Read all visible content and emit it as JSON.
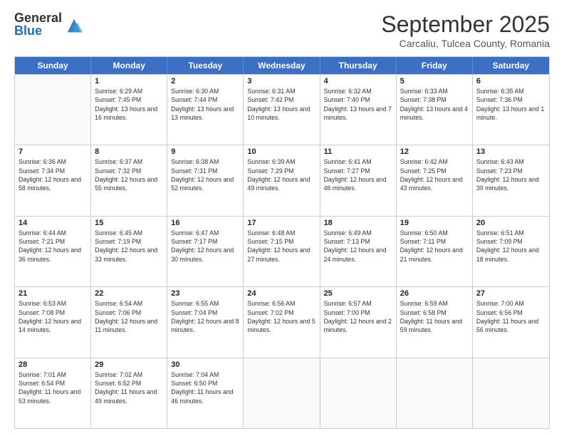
{
  "logo": {
    "general": "General",
    "blue": "Blue"
  },
  "title": "September 2025",
  "location": "Carcaliu, Tulcea County, Romania",
  "days": [
    "Sunday",
    "Monday",
    "Tuesday",
    "Wednesday",
    "Thursday",
    "Friday",
    "Saturday"
  ],
  "rows": [
    [
      {
        "day": "",
        "sunrise": "",
        "sunset": "",
        "daylight": ""
      },
      {
        "day": "1",
        "sunrise": "Sunrise: 6:29 AM",
        "sunset": "Sunset: 7:45 PM",
        "daylight": "Daylight: 13 hours and 16 minutes."
      },
      {
        "day": "2",
        "sunrise": "Sunrise: 6:30 AM",
        "sunset": "Sunset: 7:44 PM",
        "daylight": "Daylight: 13 hours and 13 minutes."
      },
      {
        "day": "3",
        "sunrise": "Sunrise: 6:31 AM",
        "sunset": "Sunset: 7:42 PM",
        "daylight": "Daylight: 13 hours and 10 minutes."
      },
      {
        "day": "4",
        "sunrise": "Sunrise: 6:32 AM",
        "sunset": "Sunset: 7:40 PM",
        "daylight": "Daylight: 13 hours and 7 minutes."
      },
      {
        "day": "5",
        "sunrise": "Sunrise: 6:33 AM",
        "sunset": "Sunset: 7:38 PM",
        "daylight": "Daylight: 13 hours and 4 minutes."
      },
      {
        "day": "6",
        "sunrise": "Sunrise: 6:35 AM",
        "sunset": "Sunset: 7:36 PM",
        "daylight": "Daylight: 13 hours and 1 minute."
      }
    ],
    [
      {
        "day": "7",
        "sunrise": "Sunrise: 6:36 AM",
        "sunset": "Sunset: 7:34 PM",
        "daylight": "Daylight: 12 hours and 58 minutes."
      },
      {
        "day": "8",
        "sunrise": "Sunrise: 6:37 AM",
        "sunset": "Sunset: 7:32 PM",
        "daylight": "Daylight: 12 hours and 55 minutes."
      },
      {
        "day": "9",
        "sunrise": "Sunrise: 6:38 AM",
        "sunset": "Sunset: 7:31 PM",
        "daylight": "Daylight: 12 hours and 52 minutes."
      },
      {
        "day": "10",
        "sunrise": "Sunrise: 6:39 AM",
        "sunset": "Sunset: 7:29 PM",
        "daylight": "Daylight: 12 hours and 49 minutes."
      },
      {
        "day": "11",
        "sunrise": "Sunrise: 6:41 AM",
        "sunset": "Sunset: 7:27 PM",
        "daylight": "Daylight: 12 hours and 46 minutes."
      },
      {
        "day": "12",
        "sunrise": "Sunrise: 6:42 AM",
        "sunset": "Sunset: 7:25 PM",
        "daylight": "Daylight: 12 hours and 43 minutes."
      },
      {
        "day": "13",
        "sunrise": "Sunrise: 6:43 AM",
        "sunset": "Sunset: 7:23 PM",
        "daylight": "Daylight: 12 hours and 39 minutes."
      }
    ],
    [
      {
        "day": "14",
        "sunrise": "Sunrise: 6:44 AM",
        "sunset": "Sunset: 7:21 PM",
        "daylight": "Daylight: 12 hours and 36 minutes."
      },
      {
        "day": "15",
        "sunrise": "Sunrise: 6:45 AM",
        "sunset": "Sunset: 7:19 PM",
        "daylight": "Daylight: 12 hours and 33 minutes."
      },
      {
        "day": "16",
        "sunrise": "Sunrise: 6:47 AM",
        "sunset": "Sunset: 7:17 PM",
        "daylight": "Daylight: 12 hours and 30 minutes."
      },
      {
        "day": "17",
        "sunrise": "Sunrise: 6:48 AM",
        "sunset": "Sunset: 7:15 PM",
        "daylight": "Daylight: 12 hours and 27 minutes."
      },
      {
        "day": "18",
        "sunrise": "Sunrise: 6:49 AM",
        "sunset": "Sunset: 7:13 PM",
        "daylight": "Daylight: 12 hours and 24 minutes."
      },
      {
        "day": "19",
        "sunrise": "Sunrise: 6:50 AM",
        "sunset": "Sunset: 7:11 PM",
        "daylight": "Daylight: 12 hours and 21 minutes."
      },
      {
        "day": "20",
        "sunrise": "Sunrise: 6:51 AM",
        "sunset": "Sunset: 7:09 PM",
        "daylight": "Daylight: 12 hours and 18 minutes."
      }
    ],
    [
      {
        "day": "21",
        "sunrise": "Sunrise: 6:53 AM",
        "sunset": "Sunset: 7:08 PM",
        "daylight": "Daylight: 12 hours and 14 minutes."
      },
      {
        "day": "22",
        "sunrise": "Sunrise: 6:54 AM",
        "sunset": "Sunset: 7:06 PM",
        "daylight": "Daylight: 12 hours and 11 minutes."
      },
      {
        "day": "23",
        "sunrise": "Sunrise: 6:55 AM",
        "sunset": "Sunset: 7:04 PM",
        "daylight": "Daylight: 12 hours and 8 minutes."
      },
      {
        "day": "24",
        "sunrise": "Sunrise: 6:56 AM",
        "sunset": "Sunset: 7:02 PM",
        "daylight": "Daylight: 12 hours and 5 minutes."
      },
      {
        "day": "25",
        "sunrise": "Sunrise: 6:57 AM",
        "sunset": "Sunset: 7:00 PM",
        "daylight": "Daylight: 12 hours and 2 minutes."
      },
      {
        "day": "26",
        "sunrise": "Sunrise: 6:59 AM",
        "sunset": "Sunset: 6:58 PM",
        "daylight": "Daylight: 11 hours and 59 minutes."
      },
      {
        "day": "27",
        "sunrise": "Sunrise: 7:00 AM",
        "sunset": "Sunset: 6:56 PM",
        "daylight": "Daylight: 11 hours and 56 minutes."
      }
    ],
    [
      {
        "day": "28",
        "sunrise": "Sunrise: 7:01 AM",
        "sunset": "Sunset: 6:54 PM",
        "daylight": "Daylight: 11 hours and 53 minutes."
      },
      {
        "day": "29",
        "sunrise": "Sunrise: 7:02 AM",
        "sunset": "Sunset: 6:52 PM",
        "daylight": "Daylight: 11 hours and 49 minutes."
      },
      {
        "day": "30",
        "sunrise": "Sunrise: 7:04 AM",
        "sunset": "Sunset: 6:50 PM",
        "daylight": "Daylight: 11 hours and 46 minutes."
      },
      {
        "day": "",
        "sunrise": "",
        "sunset": "",
        "daylight": ""
      },
      {
        "day": "",
        "sunrise": "",
        "sunset": "",
        "daylight": ""
      },
      {
        "day": "",
        "sunrise": "",
        "sunset": "",
        "daylight": ""
      },
      {
        "day": "",
        "sunrise": "",
        "sunset": "",
        "daylight": ""
      }
    ]
  ]
}
